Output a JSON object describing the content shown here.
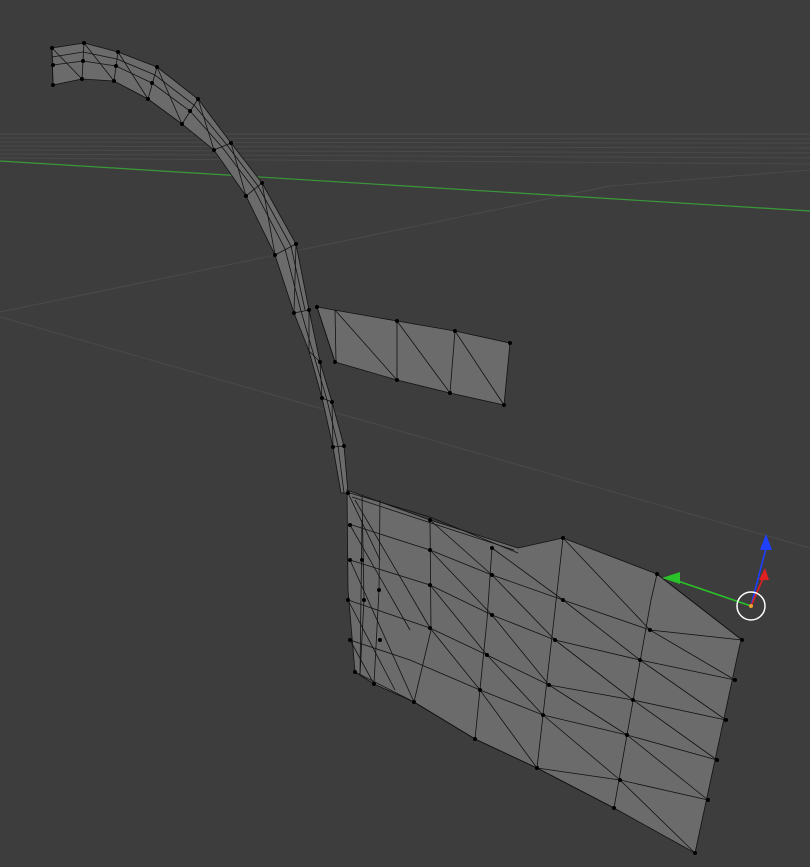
{
  "viewport": {
    "background": "#3d3d3d",
    "grid_color": "#4a4a4a",
    "y_axis_color": "#3a9a3a",
    "mesh_face_color": "#6b6b6b",
    "mesh_edge_color": "#111111",
    "vertex_color": "#000000"
  },
  "gizmo": {
    "icons": [
      "z-axis-arrow-icon",
      "y-axis-arrow-icon",
      "x-axis-arrow-icon",
      "origin-circle-icon"
    ],
    "colors": {
      "z": "#1f3fff",
      "y": "#29c229",
      "x": "#e02020",
      "circle": "#ffffff",
      "origin_dot": "#f0a030"
    }
  }
}
